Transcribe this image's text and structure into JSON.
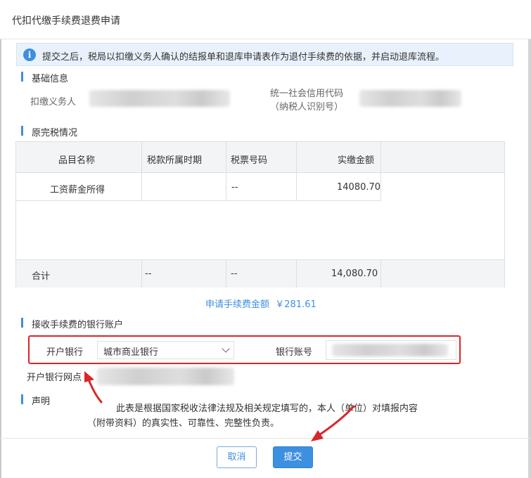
{
  "dialog": {
    "title": "代扣代缴手续费退费申请",
    "notice": "提交之后，税局以扣缴义务人确认的结报单和退库申请表作为退付手续费的依据，并启动退库流程。"
  },
  "basic_info": {
    "section_title": "基础信息",
    "withholder_label": "扣缴义务人",
    "credit_code_label_line1": "统一社会信用代码",
    "credit_code_label_line2": "（纳税人识别号）"
  },
  "tax_table": {
    "section_title": "原完税情况",
    "headers": [
      "品目名称",
      "税款所属时期",
      "税票号码",
      "实缴金额"
    ],
    "rows": [
      {
        "item": "工资薪金所得",
        "period": "",
        "ticket": "--",
        "amount": "14080.70"
      }
    ],
    "total": {
      "label": "合计",
      "period": "--",
      "ticket": "--",
      "amount": "14,080.70"
    }
  },
  "fee": {
    "label": "申请手续费金额",
    "amount": "￥281.61"
  },
  "bank": {
    "section_title": "接收手续费的银行账户",
    "bank_label": "开户银行",
    "bank_value": "城市商业银行",
    "account_label": "银行账号",
    "branch_label": "开户银行网点"
  },
  "declaration": {
    "section_title": "声明",
    "line1": "此表是根据国家税收法律法规及相关规定填写的，本人（单位）对填报内容",
    "line2": "（附带资料）的真实性、可靠性、完整性负责。"
  },
  "buttons": {
    "cancel": "取消",
    "submit": "提交"
  },
  "colors": {
    "accent": "#3d8fe0",
    "highlight_red": "#d9262a"
  },
  "icons": {
    "info": "info-icon",
    "select_arrow": "chevron-down-icon"
  }
}
